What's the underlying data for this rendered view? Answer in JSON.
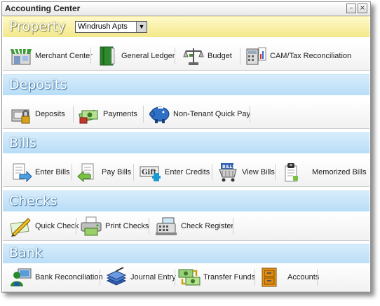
{
  "window": {
    "title": "Accounting Center",
    "minimize": "–",
    "close": "×"
  },
  "property": {
    "heading": "Property",
    "selected": "Windrush Apts",
    "arrow": "▼"
  },
  "rows": {
    "property": [
      {
        "label": "Merchant Center",
        "icon": "merchant-store-icon"
      },
      {
        "label": "General Ledger",
        "icon": "ledger-book-icon"
      },
      {
        "label": "Budget",
        "icon": "scale-icon"
      },
      {
        "label": "CAM/Tax Reconciliation",
        "icon": "calculator-chart-icon"
      }
    ],
    "deposits": [
      {
        "label": "Deposits",
        "icon": "safe-deposit-icon"
      },
      {
        "label": "Payments",
        "icon": "money-stack-icon"
      },
      {
        "label": "Non-Tenant Quick Pay",
        "icon": "piggy-bank-icon"
      }
    ],
    "bills": [
      {
        "label": "Enter Bills",
        "icon": "enter-bills-icon"
      },
      {
        "label": "Pay Bills",
        "icon": "pay-bills-icon"
      },
      {
        "label": "Enter Credits",
        "icon": "gift-credit-icon"
      },
      {
        "label": "View Bills",
        "icon": "bills-cart-icon"
      },
      {
        "label": "Memorized Bills",
        "icon": "clip-bill-icon"
      }
    ],
    "checks": [
      {
        "label": "Quick Check",
        "icon": "pen-check-icon"
      },
      {
        "label": "Print Checks",
        "icon": "printer-icon"
      },
      {
        "label": "Check Register",
        "icon": "register-icon"
      }
    ],
    "bank": [
      {
        "label": "Bank Reconciliation",
        "icon": "bank-user-icon"
      },
      {
        "label": "Journal Entry",
        "icon": "journal-book-icon"
      },
      {
        "label": "Transfer Funds",
        "icon": "transfer-money-icon"
      },
      {
        "label": "Accounts",
        "icon": "file-cabinet-icon"
      }
    ]
  },
  "headings": {
    "deposits": "Deposits",
    "bills": "Bills",
    "checks": "Checks",
    "bank": "Bank"
  }
}
